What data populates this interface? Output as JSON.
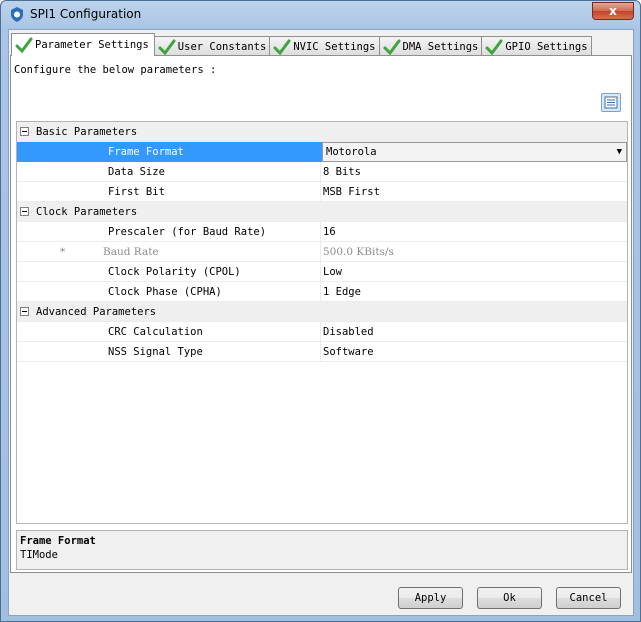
{
  "window": {
    "title": "SPI1 Configuration",
    "close_label": "x"
  },
  "tabs": [
    {
      "label": "Parameter Settings"
    },
    {
      "label": "User Constants"
    },
    {
      "label": "NVIC Settings"
    },
    {
      "label": "DMA Settings"
    },
    {
      "label": "GPIO Settings"
    }
  ],
  "instructions": "Configure the below parameters :",
  "grid": {
    "categories": {
      "basic": "Basic Parameters",
      "clock": "Clock Parameters",
      "advanced": "Advanced Parameters"
    },
    "rows": {
      "frame_format": {
        "name": "Frame Format",
        "value": "Motorola"
      },
      "data_size": {
        "name": "Data Size",
        "value": "8 Bits"
      },
      "first_bit": {
        "name": "First Bit",
        "value": "MSB First"
      },
      "prescaler": {
        "name": "Prescaler (for Baud Rate)",
        "value": "16"
      },
      "baud_rate": {
        "marker": "*",
        "name": "Baud Rate",
        "value": "500.0 KBits/s"
      },
      "cpol": {
        "name": "Clock Polarity (CPOL)",
        "value": "Low"
      },
      "cpha": {
        "name": "Clock Phase (CPHA)",
        "value": "1 Edge"
      },
      "crc": {
        "name": "CRC Calculation",
        "value": "Disabled"
      },
      "nss": {
        "name": "NSS Signal Type",
        "value": "Software"
      }
    }
  },
  "description": {
    "title": "Frame Format",
    "text": "TIMode"
  },
  "buttons": {
    "apply": "Apply",
    "ok": "Ok",
    "cancel": "Cancel"
  },
  "colors": {
    "selection": "#3399ff",
    "check": "#3fa33f",
    "titlebar": "#bcd3ec"
  }
}
